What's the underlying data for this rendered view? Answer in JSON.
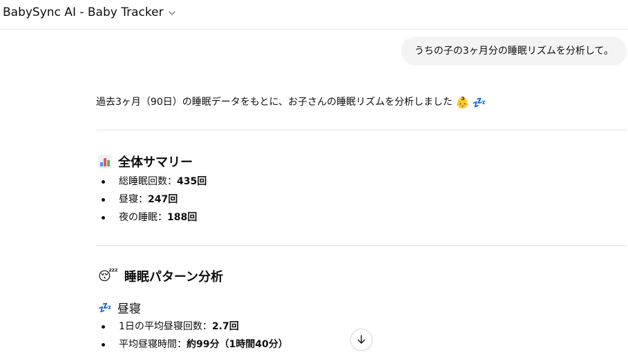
{
  "header": {
    "title": "BabySync AI - Baby Tracker",
    "dropdown_icon": "chevron-down-icon"
  },
  "user_message": "うちの子の3ヶ月分の睡眠リズムを分析して。",
  "assistant": {
    "intro": "過去3ヶ月（90日）の睡眠データをもとに、お子さんの睡眠リズムを分析しました",
    "intro_emojis": [
      "👶",
      "💤"
    ],
    "summary": {
      "icon": "bar-chart-icon",
      "title": "全体サマリー",
      "items": [
        {
          "label": "総睡眠回数：",
          "value": "435回"
        },
        {
          "label": "昼寝：",
          "value": "247回"
        },
        {
          "label": "夜の睡眠：",
          "value": "188回"
        }
      ]
    },
    "pattern": {
      "icon": "sleeping-face-icon",
      "emoji": "😴",
      "title": "睡眠パターン分析"
    },
    "nap": {
      "icon": "zzz-icon",
      "emoji": "💤",
      "title": "昼寝",
      "items": [
        {
          "label": "1日の平均昼寝回数：",
          "value": "2.7回"
        },
        {
          "label": "平均昼寝時間：",
          "value": "約99分（1時間40分）"
        }
      ]
    }
  },
  "colors": {
    "user_bubble_bg": "#f4f4f4",
    "text": "#0d0d0d",
    "divider": "#e5e5e5"
  }
}
